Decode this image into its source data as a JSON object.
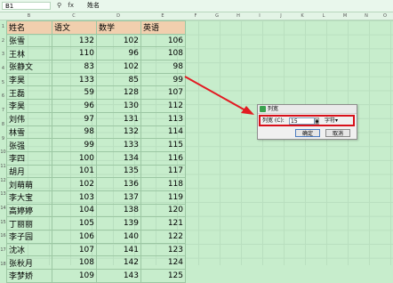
{
  "formula_bar": {
    "name_box": "B1",
    "icons": [
      "zoom-icon",
      "fx-icon"
    ],
    "icon_glyphs": [
      "⚲",
      "fx"
    ],
    "content": "姓名"
  },
  "columns": [
    "B",
    "C",
    "D",
    "E",
    "F",
    "G",
    "H",
    "I",
    "J",
    "K",
    "L",
    "M",
    "N",
    "O",
    "P",
    "Q"
  ],
  "rows": [
    "1",
    "2",
    "3",
    "4",
    "5",
    "6",
    "7",
    "8",
    "9",
    "10",
    "11",
    "12",
    "13",
    "14",
    "15",
    "16",
    "17",
    "18"
  ],
  "table": {
    "headers": [
      "姓名",
      "语文",
      "数学",
      "英语"
    ],
    "rows": [
      [
        "张雪",
        "132",
        "102",
        "106"
      ],
      [
        "王林",
        "110",
        "96",
        "108"
      ],
      [
        "张静文",
        "83",
        "102",
        "98"
      ],
      [
        "李昊",
        "133",
        "85",
        "99"
      ],
      [
        "王磊",
        "59",
        "128",
        "107"
      ],
      [
        "李昊",
        "96",
        "130",
        "112"
      ],
      [
        "刘伟",
        "97",
        "131",
        "113"
      ],
      [
        "林雪",
        "98",
        "132",
        "114"
      ],
      [
        "张强",
        "99",
        "133",
        "115"
      ],
      [
        "李四",
        "100",
        "134",
        "116"
      ],
      [
        "胡月",
        "101",
        "135",
        "117"
      ],
      [
        "刘萌萌",
        "102",
        "136",
        "118"
      ],
      [
        "李大宝",
        "103",
        "137",
        "119"
      ],
      [
        "高婷婷",
        "104",
        "138",
        "120"
      ],
      [
        "丁丽丽",
        "105",
        "139",
        "121"
      ],
      [
        "李子园",
        "106",
        "140",
        "122"
      ],
      [
        "沈冰",
        "107",
        "141",
        "123"
      ],
      [
        "张秋月",
        "108",
        "142",
        "124"
      ],
      [
        "李梦娇",
        "109",
        "143",
        "125"
      ]
    ]
  },
  "dialog": {
    "title": "列宽",
    "label": "列宽 (C):",
    "value": "15",
    "unit": "字符▾",
    "ok": "确定",
    "cancel": "取消"
  },
  "colors": {
    "sheet_bg": "#c7edcc",
    "header_fill": "#f1cfae",
    "highlight_red": "#d8101a"
  }
}
